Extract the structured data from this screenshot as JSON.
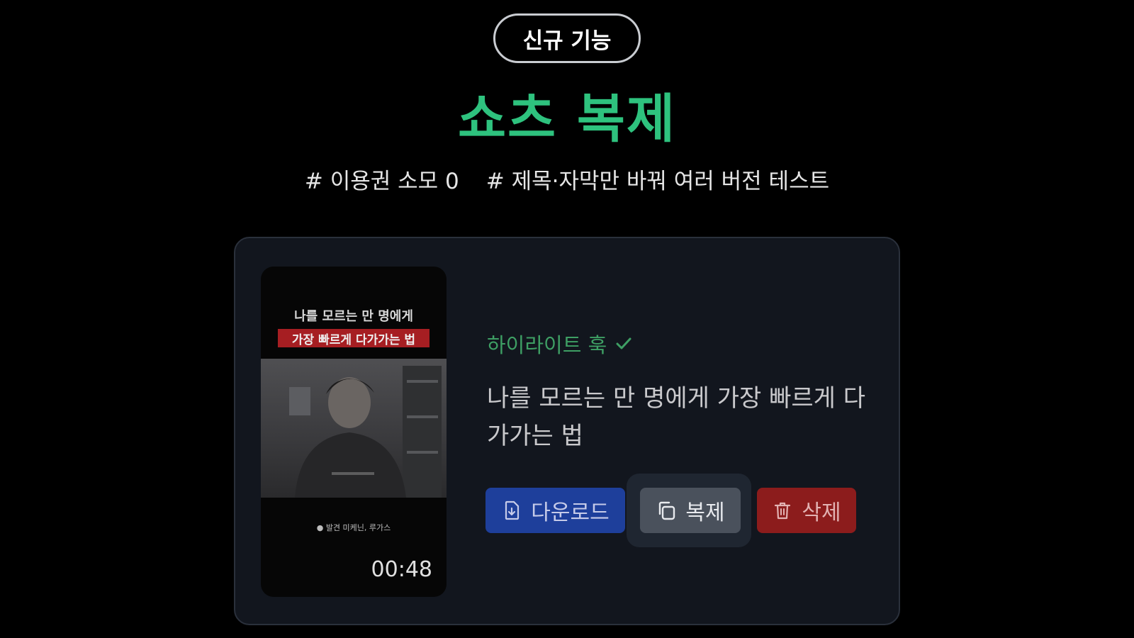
{
  "badge": "신규 기능",
  "title": "쇼츠 복제",
  "tags": [
    "# 이용권 소모 0",
    "# 제목·자막만 바꿔 여러 버전 테스트"
  ],
  "card": {
    "thumbnail": {
      "caption_line1": "나를 모르는 만 명에게",
      "caption_line2": "가장 빠르게 다가가는 법",
      "note": "● 발견 미케닌, 루가스",
      "duration": "00:48"
    },
    "hook_label": "하이라이트 훅",
    "clip_title": "나를 모르는 만 명에게 가장 빠르게 다가가는 법",
    "buttons": {
      "download": "다운로드",
      "duplicate": "복제",
      "delete": "삭제"
    }
  },
  "colors": {
    "accent_green": "#2ec27e",
    "download_blue": "#1e3f9b",
    "delete_red": "#8c1c1c"
  },
  "icons": {
    "hook": "check-icon",
    "download": "file-download-icon",
    "duplicate": "copy-icon",
    "delete": "trash-icon"
  }
}
